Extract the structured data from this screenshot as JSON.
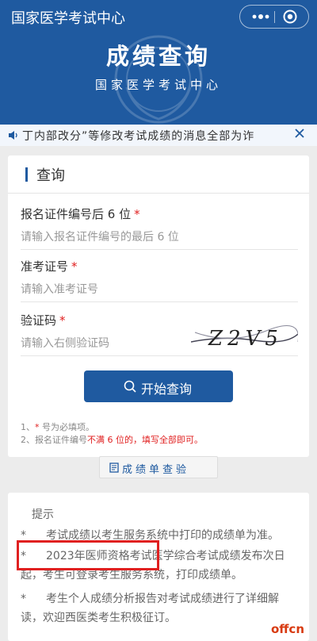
{
  "app": {
    "title": "国家医学考试中心"
  },
  "capsule": {
    "more_icon": "more-dots-icon",
    "close_icon": "target-circle-icon"
  },
  "hero": {
    "title": "成绩查询",
    "subtitle": "国家医学考试中心"
  },
  "notice": {
    "text": "丁内部改分”等修改考试成绩的消息全部为诈",
    "icon": "speaker-icon",
    "close_icon": "close-icon"
  },
  "form": {
    "title": "查询",
    "fields": [
      {
        "label": "报名证件编号后 6 位",
        "required": "*",
        "placeholder": "请输入报名证件编号的最后 6 位"
      },
      {
        "label": "准考证号",
        "required": "*",
        "placeholder": "请输入准考证号"
      },
      {
        "label": "验证码",
        "required": "*",
        "placeholder": "请输入右侧验证码"
      }
    ],
    "captcha_text": "Z2V5",
    "submit_label": "开始查询",
    "notes": {
      "n1_prefix": "1、",
      "n1_star": "*",
      "n1_text": " 号为必填项。",
      "n2_prefix": "2、报名证件编号",
      "n2_red": "不满 6 位的，填写全部即可。"
    }
  },
  "score_sheet": {
    "label": "成绩单查验"
  },
  "tips": {
    "title": "提示",
    "items": [
      "考试成绩以考生服务系统中打印的成绩单为准。",
      "2023年医师资格考试医学综合考试成绩发布次日起，考生可登录考生服务系统，打印成绩单。",
      "考生个人成绩分析报告对考试成绩进行了详细解读，欢迎西医类考生积极征订。"
    ]
  },
  "watermark": "offcn",
  "colors": {
    "primary": "#1f5aa0",
    "required": "#e02020",
    "highlight": "#e02020"
  }
}
